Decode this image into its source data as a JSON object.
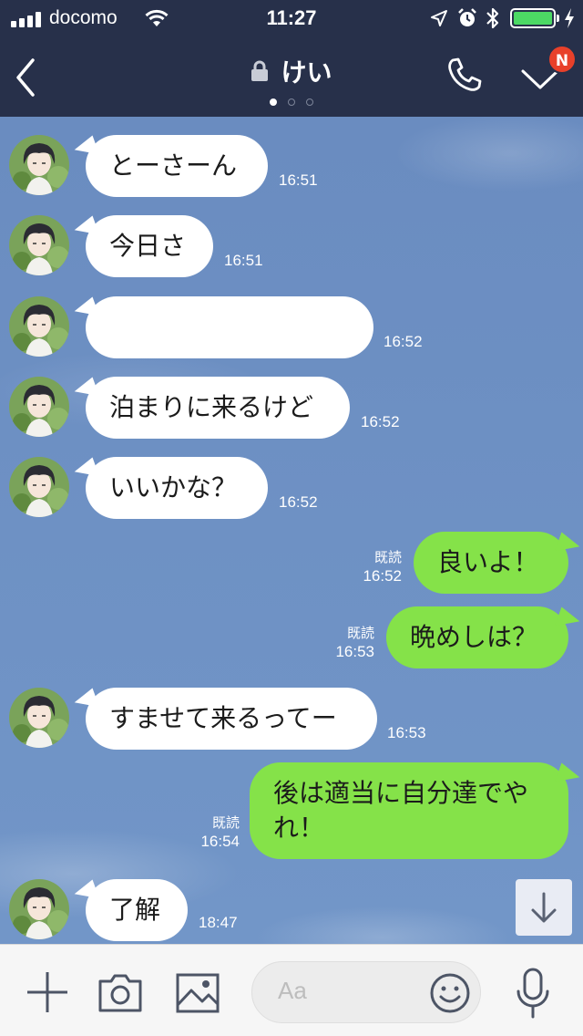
{
  "status_bar": {
    "carrier": "docomo",
    "time": "11:27",
    "battery_level": 1.0,
    "icons": [
      "signal-icon",
      "wifi-icon",
      "location-arrow-icon",
      "alarm-icon",
      "bluetooth-icon",
      "battery-icon",
      "charging-icon"
    ]
  },
  "header": {
    "title": "けい",
    "badge": "N",
    "page_dots": 3,
    "active_dot": 0,
    "icons": [
      "back-chevron-icon",
      "lock-icon",
      "phone-icon",
      "chevron-down-icon"
    ]
  },
  "messages": [
    {
      "side": "in",
      "text": "とーさーん",
      "time": "16:51"
    },
    {
      "side": "in",
      "text": "今日さ",
      "time": "16:51"
    },
    {
      "side": "in",
      "text": "",
      "time": "16:52"
    },
    {
      "side": "in",
      "text": "泊まりに来るけど",
      "time": "16:52"
    },
    {
      "side": "in",
      "text": "いいかな？",
      "time": "16:52"
    },
    {
      "side": "out",
      "text": "良いよ！",
      "read": "既読",
      "time": "16:52"
    },
    {
      "side": "out",
      "text": "晩めしは？",
      "read": "既読",
      "time": "16:53"
    },
    {
      "side": "in",
      "text": "すませて来るってー",
      "time": "16:53"
    },
    {
      "side": "out",
      "text": "後は適当に自分達でやれ！",
      "read": "既読",
      "time": "16:54"
    },
    {
      "side": "in",
      "text": "了解",
      "time": "18:47"
    }
  ],
  "input_bar": {
    "placeholder": "Aa",
    "icons": [
      "plus-icon",
      "camera-icon",
      "image-icon",
      "emoji-icon",
      "microphone-icon",
      "arrow-down-icon"
    ]
  },
  "colors": {
    "header_bg": "#27304a",
    "chat_bg": "#6d8fc2",
    "incoming_bubble": "#ffffff",
    "outgoing_bubble": "#85e249",
    "badge": "#e8402a",
    "battery": "#4cd964"
  }
}
